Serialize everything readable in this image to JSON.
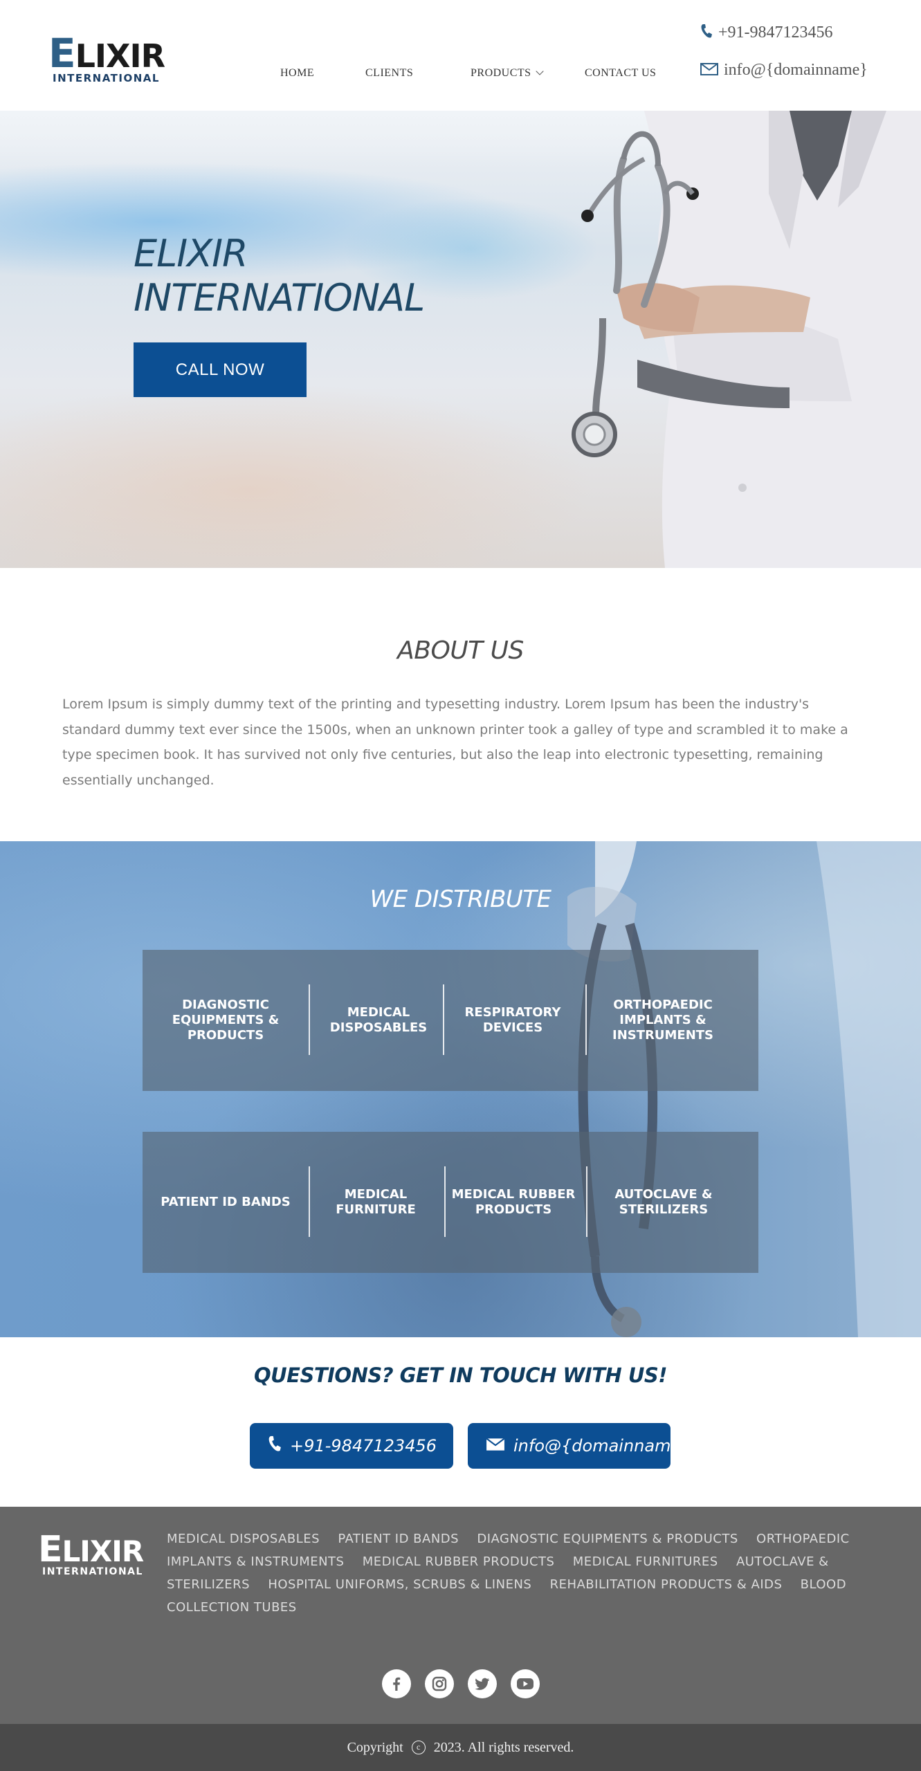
{
  "header": {
    "logo_main": "LIXIR",
    "logo_cap": "E",
    "logo_sub": "INTERNATIONAL",
    "phone": "+91-9847123456",
    "email": "info@{domainname}",
    "nav": [
      {
        "label": "HOME"
      },
      {
        "label": "CLIENTS"
      },
      {
        "label": "PRODUCTS"
      },
      {
        "label": "CONTACT US"
      }
    ]
  },
  "hero": {
    "title_line1": "ELIXIR",
    "title_line2": "INTERNATIONAL",
    "cta_label": "CALL NOW"
  },
  "about": {
    "title": "ABOUT US",
    "text": "Lorem Ipsum is simply dummy text of the printing and typesetting industry. Lorem Ipsum has been the industry's standard dummy text ever since the 1500s, when an unknown printer took a galley of type and scrambled it to make a type specimen book. It has survived not only five centuries, but also the leap into electronic typesetting, remaining essentially unchanged."
  },
  "distribute": {
    "title": "WE DISTRIBUTE",
    "row1": [
      {
        "label": "DIAGNOSTIC EQUIPMENTS & PRODUCTS"
      },
      {
        "label": "MEDICAL DISPOSABLES"
      },
      {
        "label": "RESPIRATORY DEVICES"
      },
      {
        "label": "ORTHOPAEDIC IMPLANTS & INSTRUMENTS"
      }
    ],
    "row2": [
      {
        "label": "PATIENT ID BANDS"
      },
      {
        "label": "MEDICAL FURNITURE"
      },
      {
        "label": "MEDICAL RUBBER PRODUCTS"
      },
      {
        "label": "AUTOCLAVE & STERILIZERS"
      }
    ]
  },
  "contact": {
    "title": "QUESTIONS? GET IN TOUCH WITH US!",
    "phone_label": "+91-9847123456",
    "email_label": "info@{domainname}."
  },
  "footer": {
    "logo_main": "LIXIR",
    "logo_cap": "E",
    "logo_sub": "INTERNATIONAL",
    "links": [
      "MEDICAL DISPOSABLES",
      "PATIENT ID BANDS",
      "DIAGNOSTIC EQUIPMENTS & PRODUCTS",
      "ORTHOPAEDIC IMPLANTS & INSTRUMENTS",
      "MEDICAL RUBBER PRODUCTS",
      "MEDICAL FURNITURES",
      "AUTOCLAVE & STERILIZERS",
      "HOSPITAL UNIFORMS, SCRUBS & LINENS",
      "REHABILITATION PRODUCTS & AIDS",
      "BLOOD COLLECTION TUBES"
    ],
    "socials": [
      "facebook-icon",
      "instagram-icon",
      "twitter-icon",
      "youtube-icon"
    ],
    "copyright_prefix": "Copyright",
    "copyright_suffix": "2023. All rights reserved."
  },
  "colors": {
    "brand_blue": "#0c4f93",
    "heading_dark": "#1e4866",
    "footer_bg": "#676767",
    "copyright_bg": "#4a4a4a"
  }
}
